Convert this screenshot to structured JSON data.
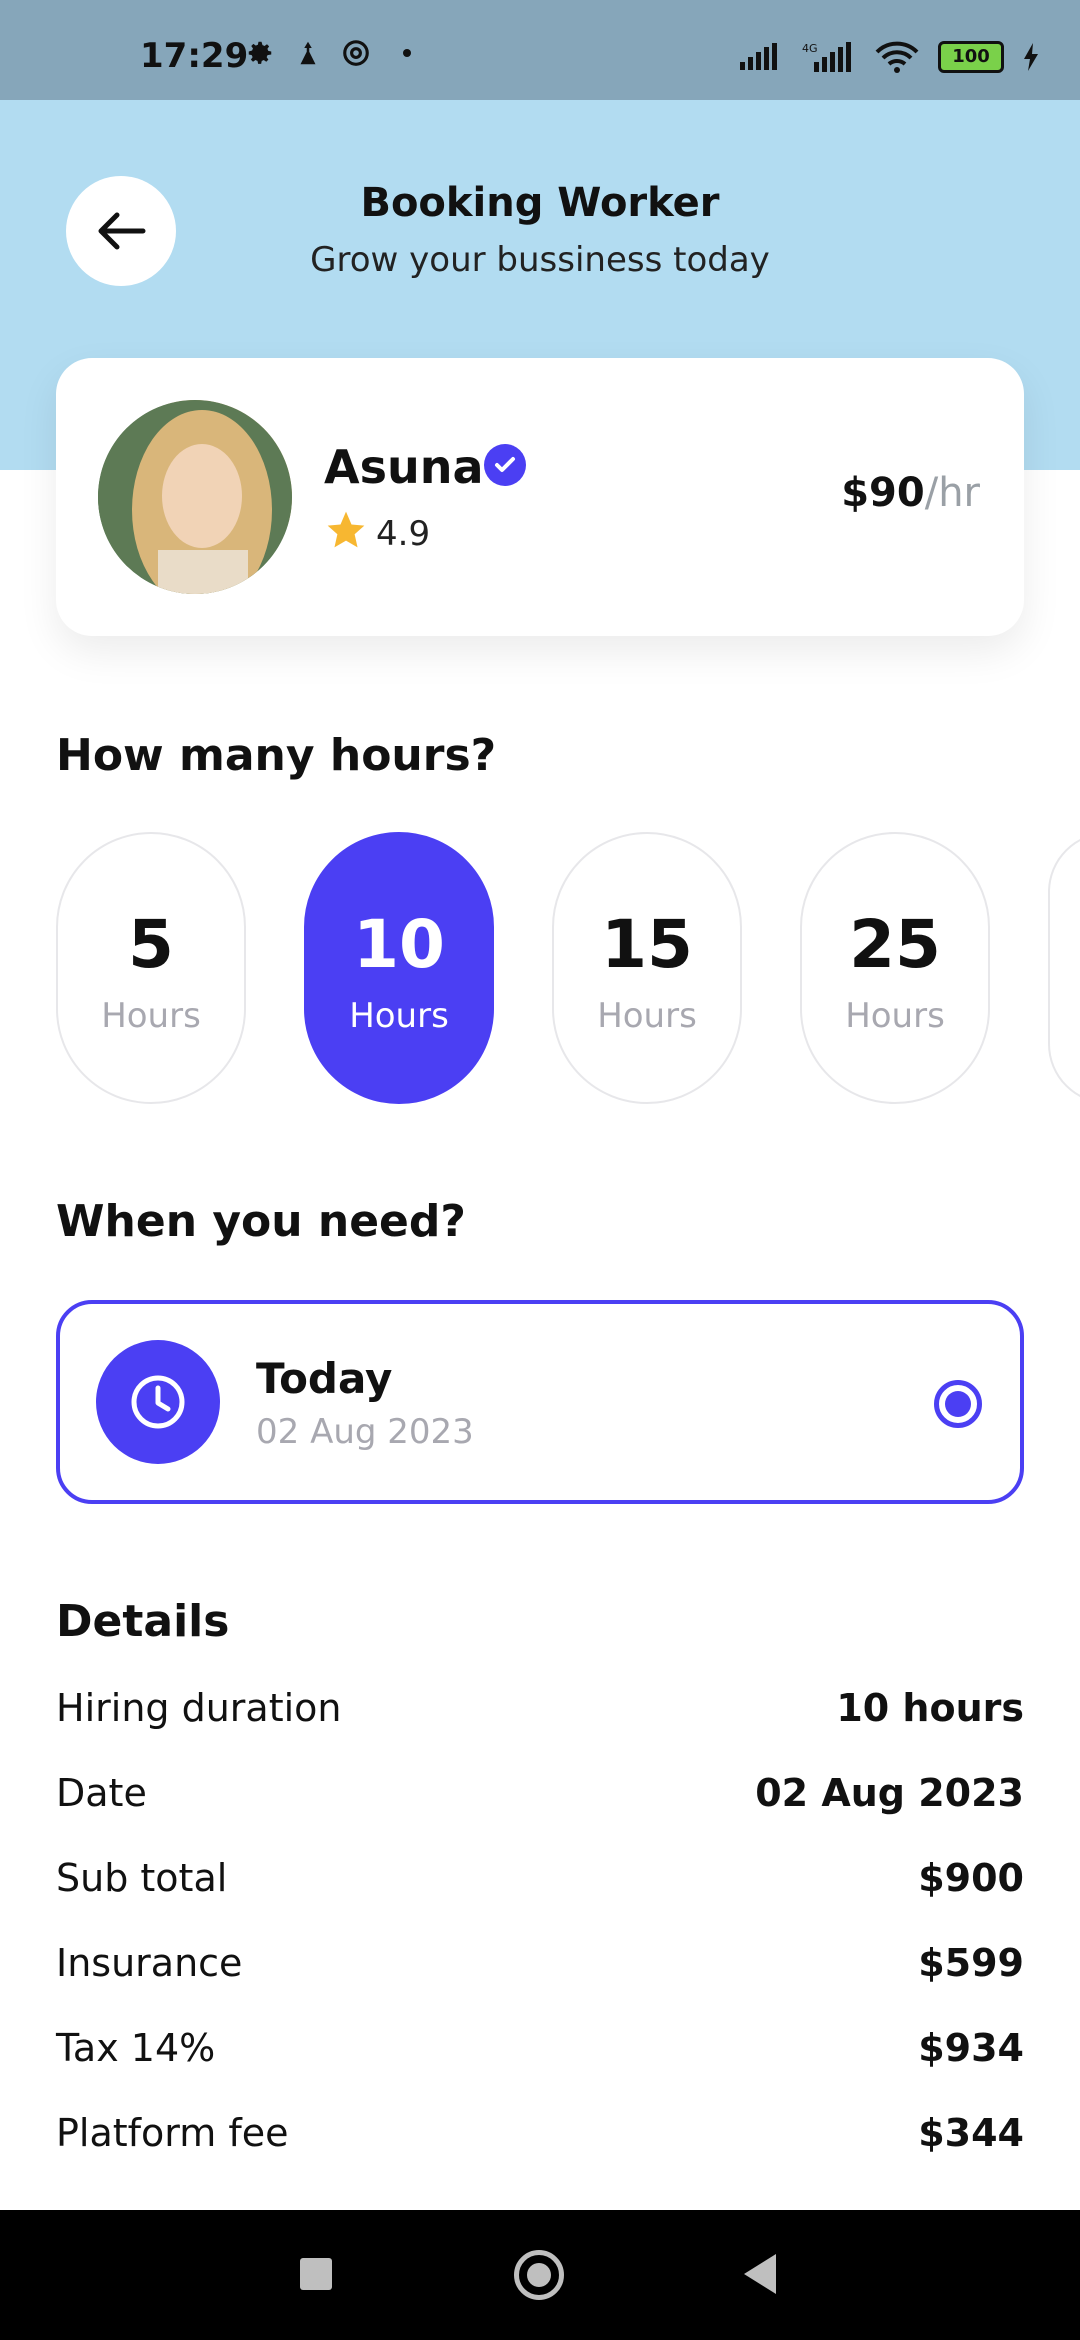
{
  "status_bar": {
    "time": "17:29",
    "battery": "100",
    "network": "4G"
  },
  "header": {
    "title": "Booking Worker",
    "subtitle": "Grow your bussiness today"
  },
  "worker": {
    "name": "Asuna",
    "rating": "4.9",
    "price": "$90",
    "price_unit": "/hr"
  },
  "hours_section": {
    "title": "How many hours?",
    "options": [
      {
        "value": "5",
        "label": "Hours",
        "selected": false
      },
      {
        "value": "10",
        "label": "Hours",
        "selected": true
      },
      {
        "value": "15",
        "label": "Hours",
        "selected": false
      },
      {
        "value": "25",
        "label": "Hours",
        "selected": false
      }
    ]
  },
  "when_section": {
    "title": "When you need?",
    "option": {
      "label": "Today",
      "date": "02 Aug 2023",
      "selected": true
    }
  },
  "details": {
    "title": "Details",
    "rows": [
      {
        "label": "Hiring duration",
        "value": "10 hours"
      },
      {
        "label": "Date",
        "value": "02 Aug 2023"
      },
      {
        "label": "Sub total",
        "value": "$900"
      },
      {
        "label": "Insurance",
        "value": "$599"
      },
      {
        "label": "Tax 14%",
        "value": "$934"
      },
      {
        "label": "Platform fee",
        "value": "$344"
      }
    ]
  },
  "colors": {
    "accent": "#4b3ff3",
    "header_bg": "#b2dcf1",
    "status_bar_bg": "#86a6ba",
    "star": "#f7b731"
  },
  "icons": {
    "back": "arrow-left-icon",
    "verified": "check-badge-icon",
    "star": "star-icon",
    "clock": "clock-icon"
  }
}
